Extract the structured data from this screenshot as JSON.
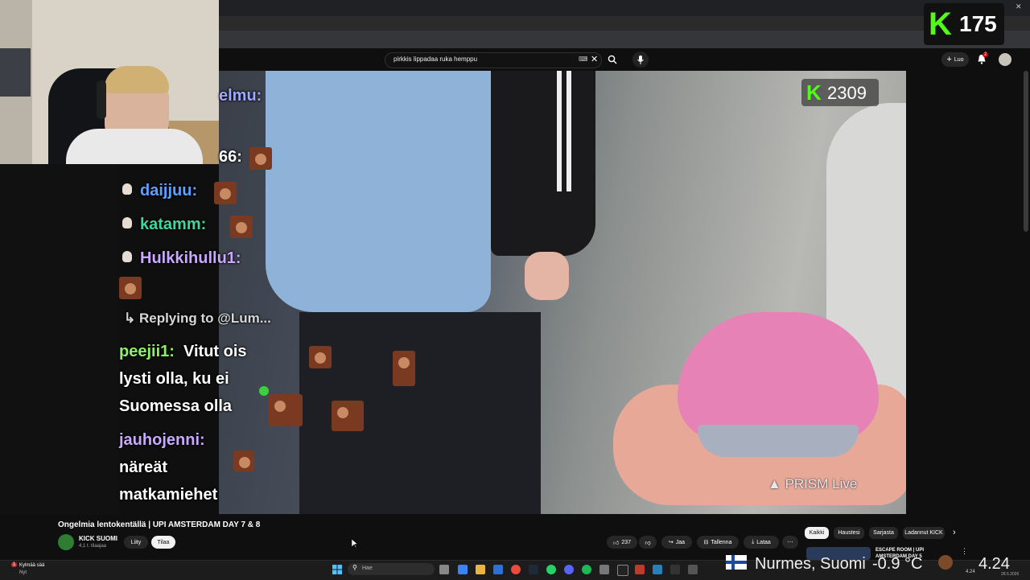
{
  "browser": {
    "window_controls": [
      "–",
      "□",
      "✕"
    ]
  },
  "header": {
    "search_value": "pirkkis lippadaa ruka hemppu",
    "create_label": "Luo",
    "notification_count": "2"
  },
  "kick_badge": {
    "letter": "K",
    "count": "175"
  },
  "stream_overlay": {
    "viewer_badge": "2309",
    "watermark": "PRISM Live"
  },
  "chat": {
    "lines": [
      {
        "user": "elmu:",
        "color": "#9fa8ff"
      },
      {
        "user": "66:",
        "color": "#ffffff"
      },
      {
        "user": "daijjuu:",
        "color": "#5fa0ff"
      },
      {
        "user": "katamm:",
        "color": "#3fd6a0"
      },
      {
        "user": "Hulkkihullu1:",
        "color": "#c9a8ff"
      }
    ],
    "reply_label": "Replying to @Lum...",
    "reply_user": "peejii1:",
    "reply_message_1": "Vitut ois",
    "reply_message_2": "lysti olla, ku ei",
    "reply_message_3": "Suomessa olla",
    "last_user": "jauhojenni:",
    "last_message_1": "näreät",
    "last_message_2": "matkamiehet"
  },
  "video": {
    "title": "Ongelmia lentokentällä | UPI AMSTERDAM DAY 7 & 8",
    "channel": "KICK SUOMI",
    "subscribers": "4,1 t. tilaajaa",
    "join_label": "Liity",
    "subscribe_label": "Tilaa",
    "likes": "237",
    "share_label": "Jaa",
    "save_label": "Tallenna",
    "download_label": "Lataa"
  },
  "chips": [
    "Kaikki",
    "Haustesi",
    "Sarjasta",
    "Ladannut KICK"
  ],
  "recommended": {
    "title_line1": "ESCAPE ROOM | UPI",
    "title_line2": "AMSTERDAM DAY 5"
  },
  "taskbar": {
    "weather_alert": "1",
    "weather_label": "Kylmää sää",
    "weather_sub": "Nyt",
    "search_placeholder": "Hae",
    "clock_time": "4.24",
    "clock_date": "28.5.2026"
  },
  "location_overlay": {
    "text": "Nurmes, Suomi",
    "temperature": "-0.9 °C",
    "time": "4.24"
  },
  "colors": {
    "kick_green": "#53fc18",
    "youtube_bg": "#0f0f0f",
    "accent_red": "#ff0000"
  }
}
